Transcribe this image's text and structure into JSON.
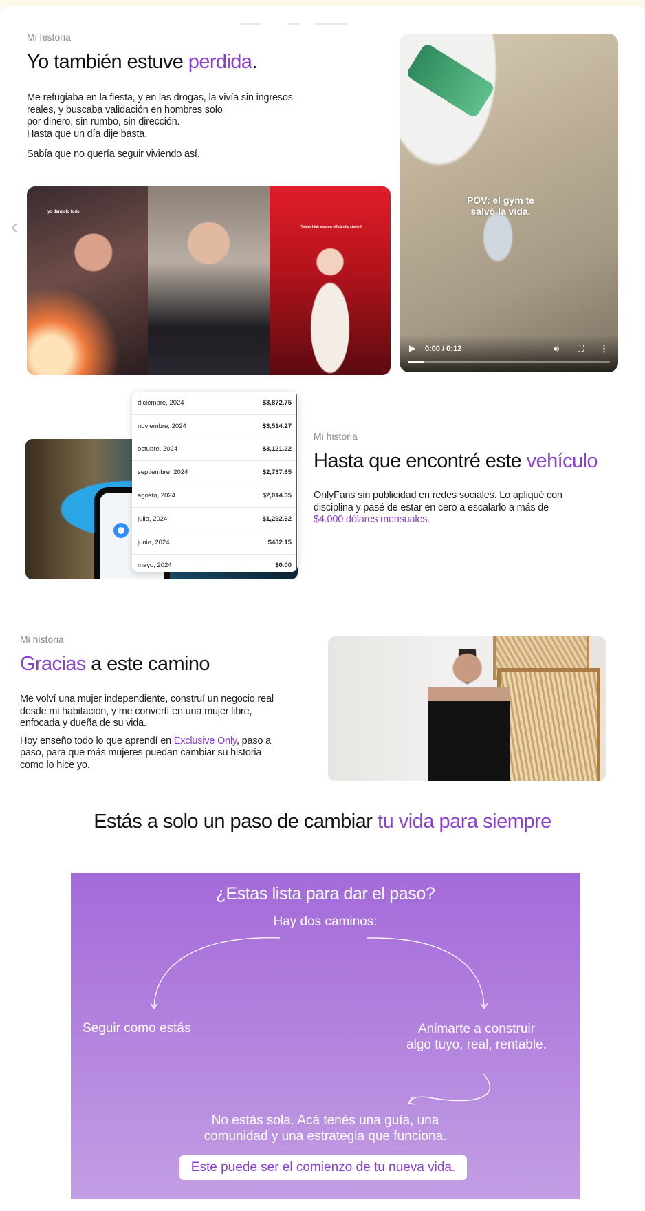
{
  "section1": {
    "eyebrow": "Mi historia",
    "title_a": "Yo también estuve ",
    "title_b": "perdida",
    "title_c": ".",
    "body_lines": [
      "Me refugiaba en la fiesta, y en las drogas, la vivía sin ingresos",
      "reales, y buscaba validación en hombres solo",
      "por dinero, sin rumbo, sin dirección.",
      "Hasta que un día dije basta."
    ],
    "highlight": "Sabía que no quería seguir viviendo así.",
    "photo1_tag": "yo dandolo todo",
    "photo3_tag": "Tulum high season efficiently started"
  },
  "video": {
    "caption_line1": "POV: el gym te",
    "caption_line2": "salvó la vida.",
    "time": "0:00 / 0:12",
    "progress": 0.08,
    "icons": [
      "play-icon",
      "volume-icon",
      "fullscreen-icon",
      "more-options-icon"
    ]
  },
  "earnings": {
    "rows": [
      {
        "month": "diciembre, 2024",
        "amount": "$3,872.75"
      },
      {
        "month": "noviembre, 2024",
        "amount": "$3,514.27"
      },
      {
        "month": "octubre, 2024",
        "amount": "$3,121.22"
      },
      {
        "month": "septiembre, 2024",
        "amount": "$2,737.65"
      },
      {
        "month": "agosto, 2024",
        "amount": "$2,014.35"
      },
      {
        "month": "julio, 2024",
        "amount": "$1,292.62"
      },
      {
        "month": "junio, 2024",
        "amount": "$432.15"
      },
      {
        "month": "mayo, 2024",
        "amount": "$0.00"
      }
    ]
  },
  "section2": {
    "eyebrow": "Mi historia",
    "title_a": "Hasta que encontré este ",
    "title_b": "vehículo",
    "body_lines": [
      "OnlyFans sin publicidad en redes sociales. Lo apliqué con",
      "disciplina y pasé de estar en cero a escalarlo a más de"
    ],
    "highlight": "$4.000 dólares mensuales."
  },
  "section3": {
    "eyebrow": "Mi historia",
    "title_a": "Gracias",
    "title_b": " a este camino",
    "para1_lines": [
      "Me volví una mujer independiente, construí un negocio real",
      "desde mi habitación, y me convertí en una mujer libre,",
      "enfocada y dueña de su vida."
    ],
    "para2_a": "Hoy enseño todo lo que aprendí en ",
    "para2_link": "Exclusive Only",
    "para2_b": ", paso a",
    "para2_lines": [
      "paso, para que más mujeres puedan cambiar su historia",
      "como lo hice yo."
    ]
  },
  "headline": {
    "text_a": "Estás a solo un paso de cambiar ",
    "text_b": "tu vida para siempre"
  },
  "cta": {
    "question": "¿Estas lista para dar el paso?",
    "subtitle": "Hay dos caminos:",
    "left_option": "Seguir como estás",
    "right_option_line1": "Animarte a construir",
    "right_option_line2": "algo tuyo, real, rentable.",
    "message_line1": "No estás sola. Acá tenés una guía, una",
    "message_line2": "comunidad y una estrategia que funciona.",
    "button": "Este puede ser el comienzo de tu nueva vida."
  },
  "colors": {
    "accent": "#8a3fd1",
    "cta_top": "#a46ada",
    "cta_bottom": "#c39ee4",
    "page_bg": "#fdf8ea"
  }
}
